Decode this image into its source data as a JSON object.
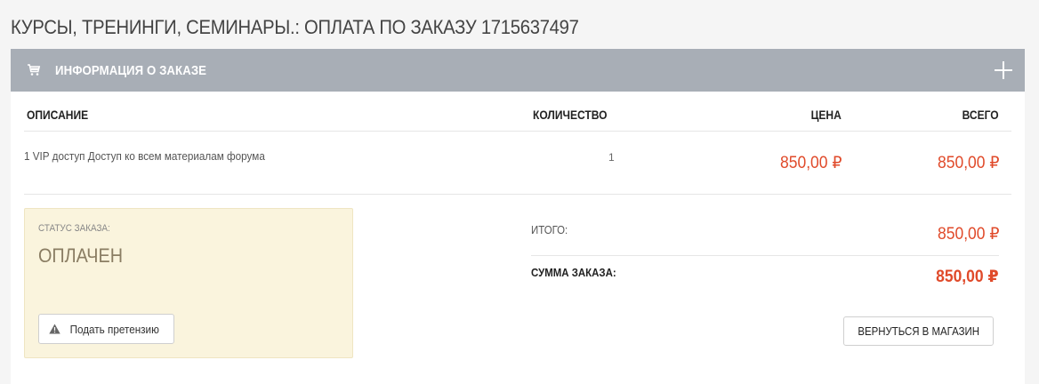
{
  "page": {
    "title": "КУРСЫ, ТРЕНИНГИ, СЕМИНАРЫ.: ОПЛАТА ПО ЗАКАЗУ 1715637497"
  },
  "panel": {
    "title": "ИНФОРМАЦИЯ О ЗАКАЗЕ",
    "icon": "cart-icon",
    "toggle_icon": "plus-icon",
    "header_color": "#a8aeb6"
  },
  "table": {
    "columns": [
      "ОПИСАНИЕ",
      "КОЛИЧЕСТВО",
      "ЦЕНА",
      "ВСЕГО"
    ],
    "rows": [
      {
        "description": "1 VIP доступ Доступ ко всем материалам форума",
        "quantity": "1",
        "price": "850,00 ₽",
        "total": "850,00 ₽"
      }
    ]
  },
  "status": {
    "label": "СТАТУС ЗАКАЗА:",
    "value": "ОПЛАЧЕН",
    "claim_button": "Подать претензию",
    "claim_icon": "warning-icon"
  },
  "summary": {
    "subtotal_label": "ИТОГО:",
    "subtotal_value": "850,00 ₽",
    "total_label": "СУММА ЗАКАЗА:",
    "total_value": "850,00 ₽",
    "accent_color": "#e04a2a"
  },
  "actions": {
    "back_button": "ВЕРНУТЬСЯ В МАГАЗИН"
  }
}
